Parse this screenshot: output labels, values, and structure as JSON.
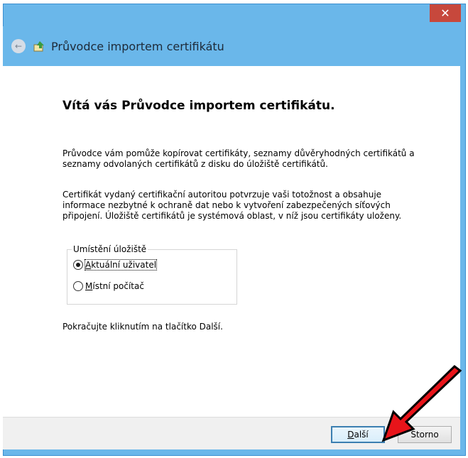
{
  "window": {
    "close_glyph": "✕"
  },
  "header": {
    "back_glyph": "←",
    "title": "Průvodce importem certifikátu"
  },
  "content": {
    "welcome": "Vítá vás Průvodce importem certifikátu.",
    "paragraph1": "Průvodce vám pomůže kopírovat certifikáty, seznamy důvěryhodných certifikátů a seznamy odvolaných certifikátů z disku do úložiště certifikátů.",
    "paragraph2": "Certifikát vydaný certifikační autoritou potvrzuje vaši totožnost a obsahuje informace nezbytné k ochraně dat nebo k vytvoření zabezpečených síťových připojení. Úložiště certifikátů je systémová oblast, v níž jsou certifikáty uloženy.",
    "store_group": {
      "legend": "Umístění úložiště",
      "options": [
        {
          "label_first": "A",
          "label_rest": "ktuální uživatel",
          "selected": true
        },
        {
          "label_first": "M",
          "label_rest": "ístní počítač",
          "selected": false
        }
      ]
    },
    "continue_hint": "Pokračujte kliknutím na tlačítko Další."
  },
  "buttons": {
    "next_first": "D",
    "next_rest": "alší",
    "cancel": "Storno"
  },
  "colors": {
    "title_bar": "#6ab7ea",
    "close": "#c7483c",
    "arrow": "#e8141a"
  },
  "icons": {
    "back": "back-arrow-icon",
    "wizard": "certificate-wizard-icon"
  }
}
